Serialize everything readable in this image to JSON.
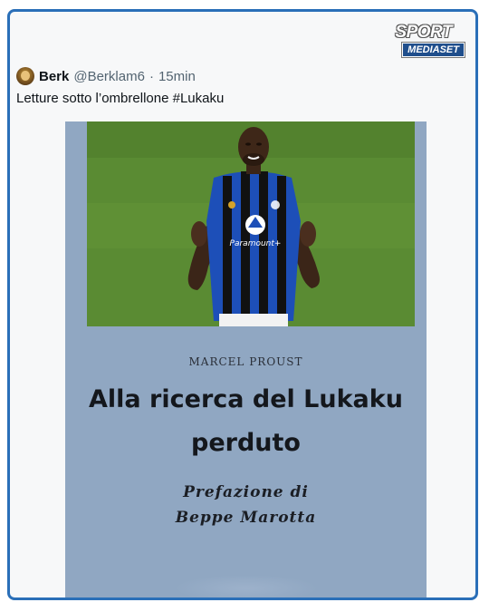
{
  "brand": {
    "line1": "SPORT",
    "line2": "MEDIASET"
  },
  "tweet": {
    "author_name": "Berk",
    "handle": "@Berklam6",
    "separator": "·",
    "time": "15min",
    "text": "Letture sotto l’ombrellone #Lukaku"
  },
  "book": {
    "author": "MARCEL PROUST",
    "title_line1": "Alla ricerca del Lukaku",
    "title_line2": "perduto",
    "preface_line1": "Prefazione di",
    "preface_line2": "Beppe Marotta"
  },
  "photo": {
    "subject": "football-player-photo",
    "shirt_sponsor": "Paramount+"
  },
  "colors": {
    "frame_border": "#2a6fb8",
    "book_cover": "#90a7c2",
    "pitch": "#5f9035",
    "jersey_blue": "#1d4fb8",
    "jersey_black": "#111111"
  }
}
